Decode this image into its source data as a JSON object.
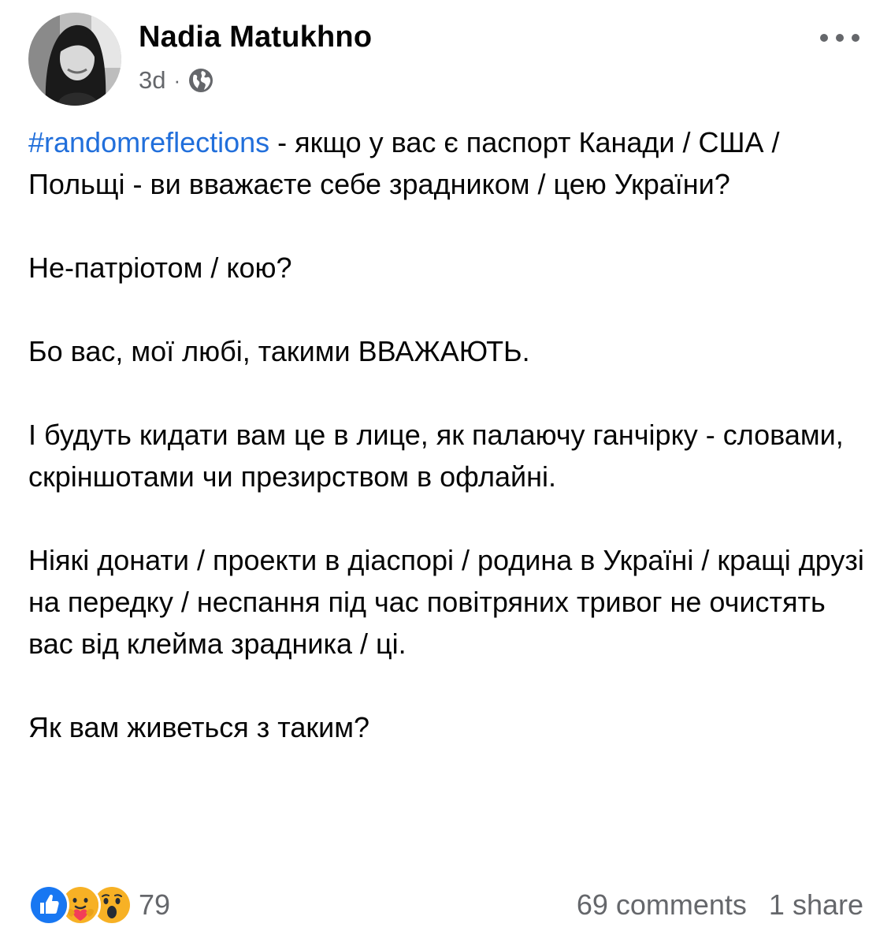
{
  "post": {
    "author": {
      "name": "Nadia Matukhno",
      "avatar_icon": "profile-photo"
    },
    "timestamp": "3d",
    "separator": "·",
    "audience_icon": "globe-icon",
    "more_icon": "more-horizontal-icon",
    "hashtag": "#randomreflections",
    "paragraphs": {
      "p1_rest": " - якщо у вас є паспорт Канади / США / Польщі - ви вважаєте себе зрадником / цею України?",
      "p2": "Не-патріотом / кою?",
      "p3": "Бо вас, мої любі, такими ВВАЖАЮТЬ.",
      "p4": "І будуть кидати вам це в лице, як палаючу ганчірку - словами, скріншотами чи презирством в офлайні.",
      "p5": "Ніякі донати / проекти в діаспорі / родина в Україні / кращі друзі на передку / неспання під час повітряних тривог не очистять вас від клейма зрадника / ці.",
      "p6": "Як вам живеться з таким?"
    },
    "reactions": {
      "icons": [
        "like-icon",
        "care-icon",
        "wow-icon"
      ],
      "count": "79"
    },
    "comments": "69 comments",
    "shares": "1 share"
  },
  "colors": {
    "hashtag": "#216fdb",
    "secondary_text": "#65676b",
    "like_blue": "#1877f2",
    "reaction_yellow": "#f7b125"
  }
}
